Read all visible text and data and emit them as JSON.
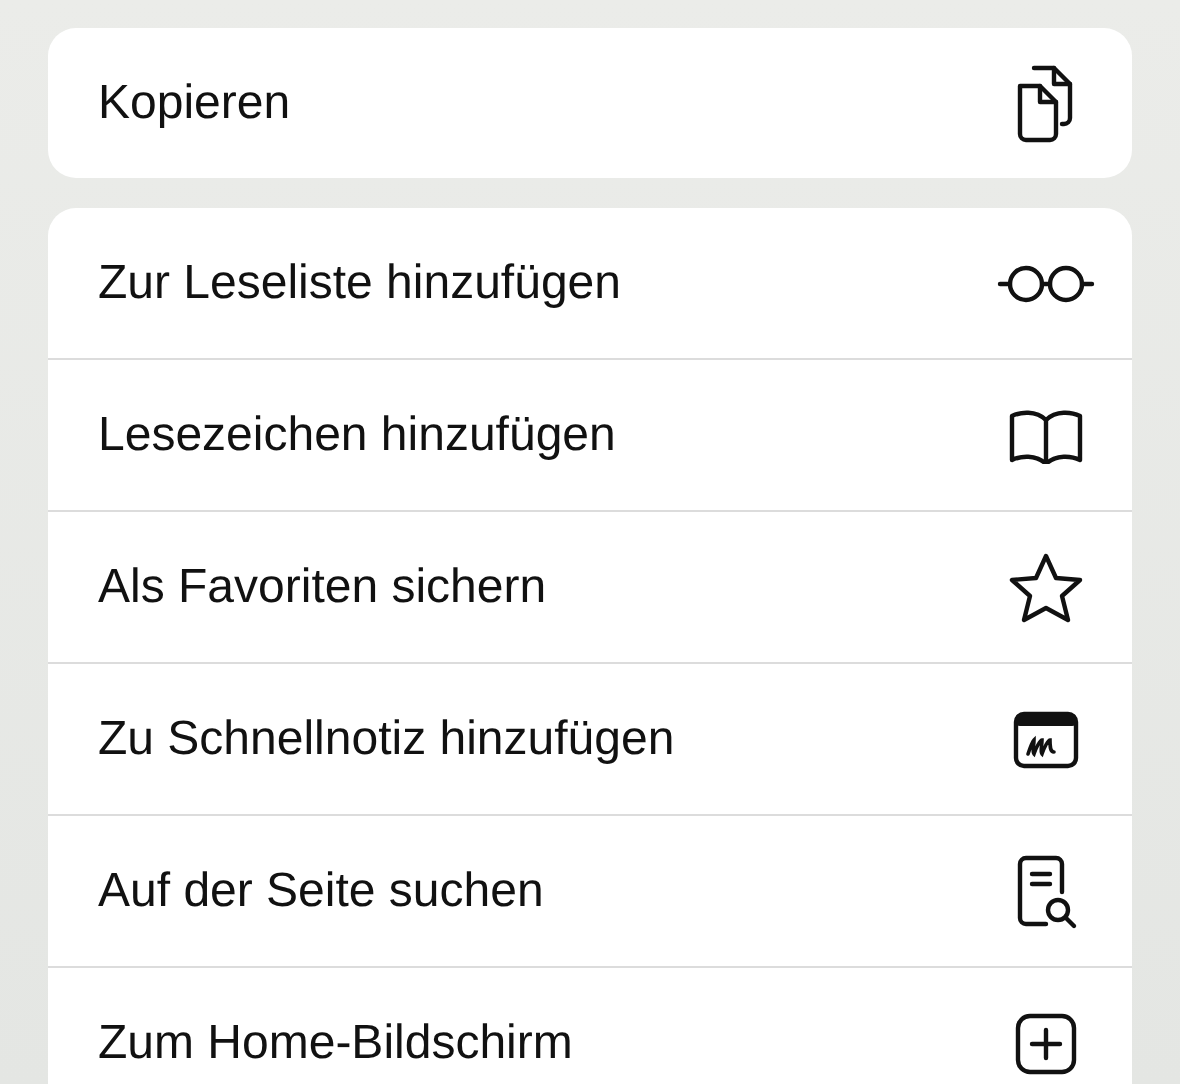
{
  "groups": [
    {
      "items": [
        {
          "label": "Kopieren"
        }
      ]
    },
    {
      "items": [
        {
          "label": "Zur Leseliste hinzufügen"
        },
        {
          "label": "Lesezeichen hinzufügen"
        },
        {
          "label": "Als Favoriten sichern"
        },
        {
          "label": "Zu Schnellnotiz hinzufügen"
        },
        {
          "label": "Auf der Seite suchen"
        },
        {
          "label": "Zum Home-Bildschirm"
        }
      ]
    }
  ]
}
